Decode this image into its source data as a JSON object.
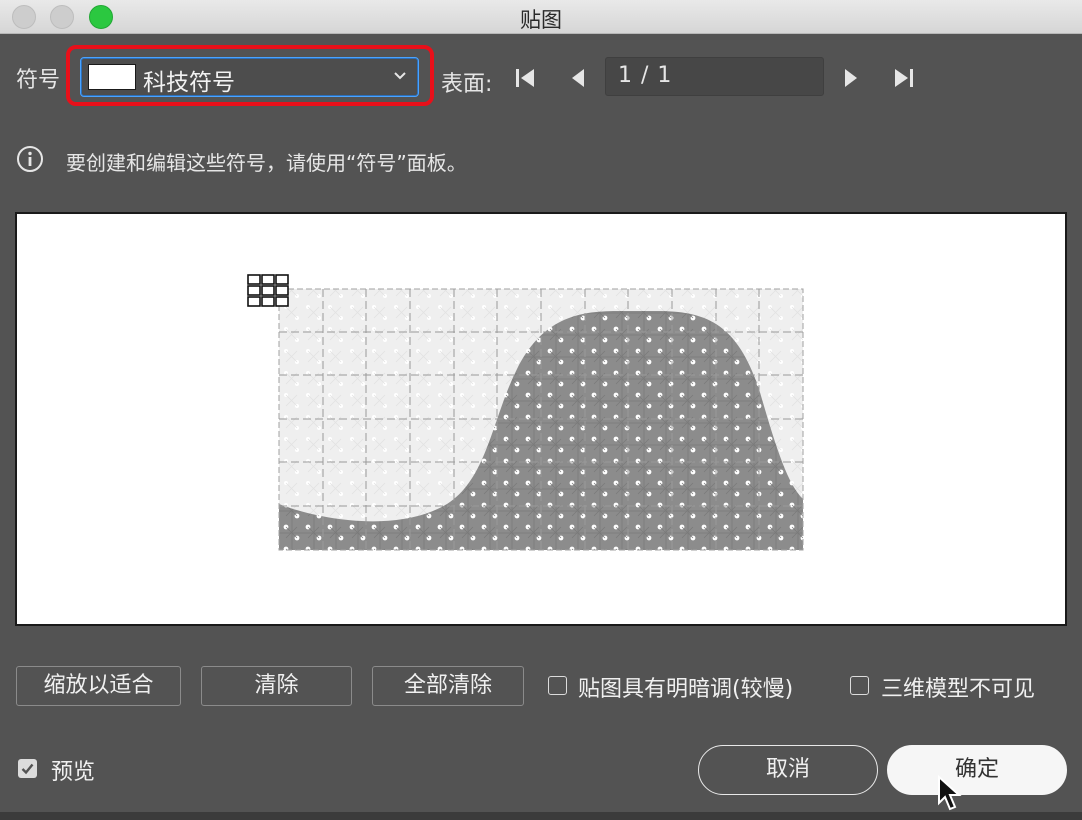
{
  "window": {
    "title": "贴图"
  },
  "symbol": {
    "label": "符号",
    "selected": "科技符号"
  },
  "surface": {
    "label": "表面:",
    "page": "1 / 1"
  },
  "info": {
    "text": "要创建和编辑这些符号，请使用“符号”面板。"
  },
  "buttons": {
    "fit": "缩放以适合",
    "clear": "清除",
    "clear_all": "全部清除",
    "cancel": "取消",
    "ok": "确定"
  },
  "options": {
    "shade_label": "贴图具有明暗调(较慢)",
    "shade_checked": false,
    "invisible_label": "三维模型不可见",
    "invisible_checked": false,
    "preview_label": "预览",
    "preview_checked": true
  },
  "colors": {
    "highlight": "#e8101a",
    "accent": "#2bc840"
  }
}
